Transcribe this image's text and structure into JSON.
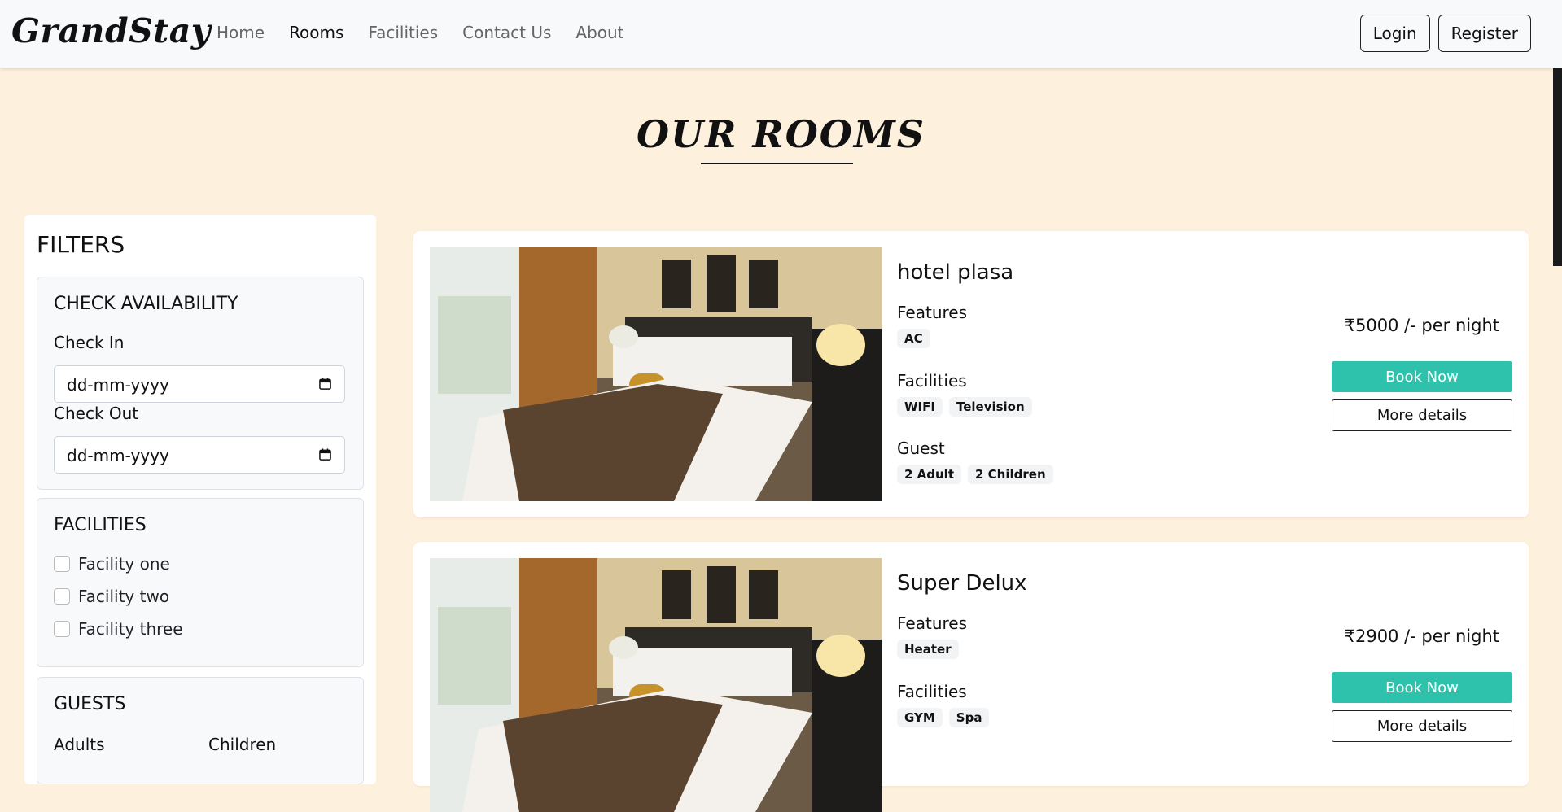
{
  "nav": {
    "brand": "GrandStay",
    "links": [
      "Home",
      "Rooms",
      "Facilities",
      "Contact Us",
      "About"
    ],
    "login": "Login",
    "register": "Register"
  },
  "page_title": "OUR ROOMS",
  "filters": {
    "title": "FILTERS",
    "availability": {
      "title": "CHECK AVAILABILITY",
      "check_in_label": "Check In",
      "check_in_value": "dd-mm-yyyy",
      "check_out_label": "Check Out",
      "check_out_value": "dd-mm-yyyy"
    },
    "facilities": {
      "title": "FACILITIES",
      "options": [
        "Facility one",
        "Facility two",
        "Facility three"
      ]
    },
    "guests": {
      "title": "GUESTS",
      "adults_label": "Adults",
      "children_label": "Children"
    }
  },
  "rooms": [
    {
      "name": "hotel plasa",
      "features_title": "Features",
      "features": [
        "AC"
      ],
      "facilities_title": "Facilities",
      "facilities": [
        "WIFI",
        "Television"
      ],
      "guest_title": "Guest",
      "guests": [
        "2 Adult",
        "2 Children"
      ],
      "price": "₹5000 /- per night",
      "book": "Book Now",
      "details": "More details"
    },
    {
      "name": "Super Delux",
      "features_title": "Features",
      "features": [
        "Heater"
      ],
      "facilities_title": "Facilities",
      "facilities": [
        "GYM",
        "Spa"
      ],
      "price": "₹2900 /- per night",
      "book": "Book Now",
      "details": "More details"
    }
  ]
}
